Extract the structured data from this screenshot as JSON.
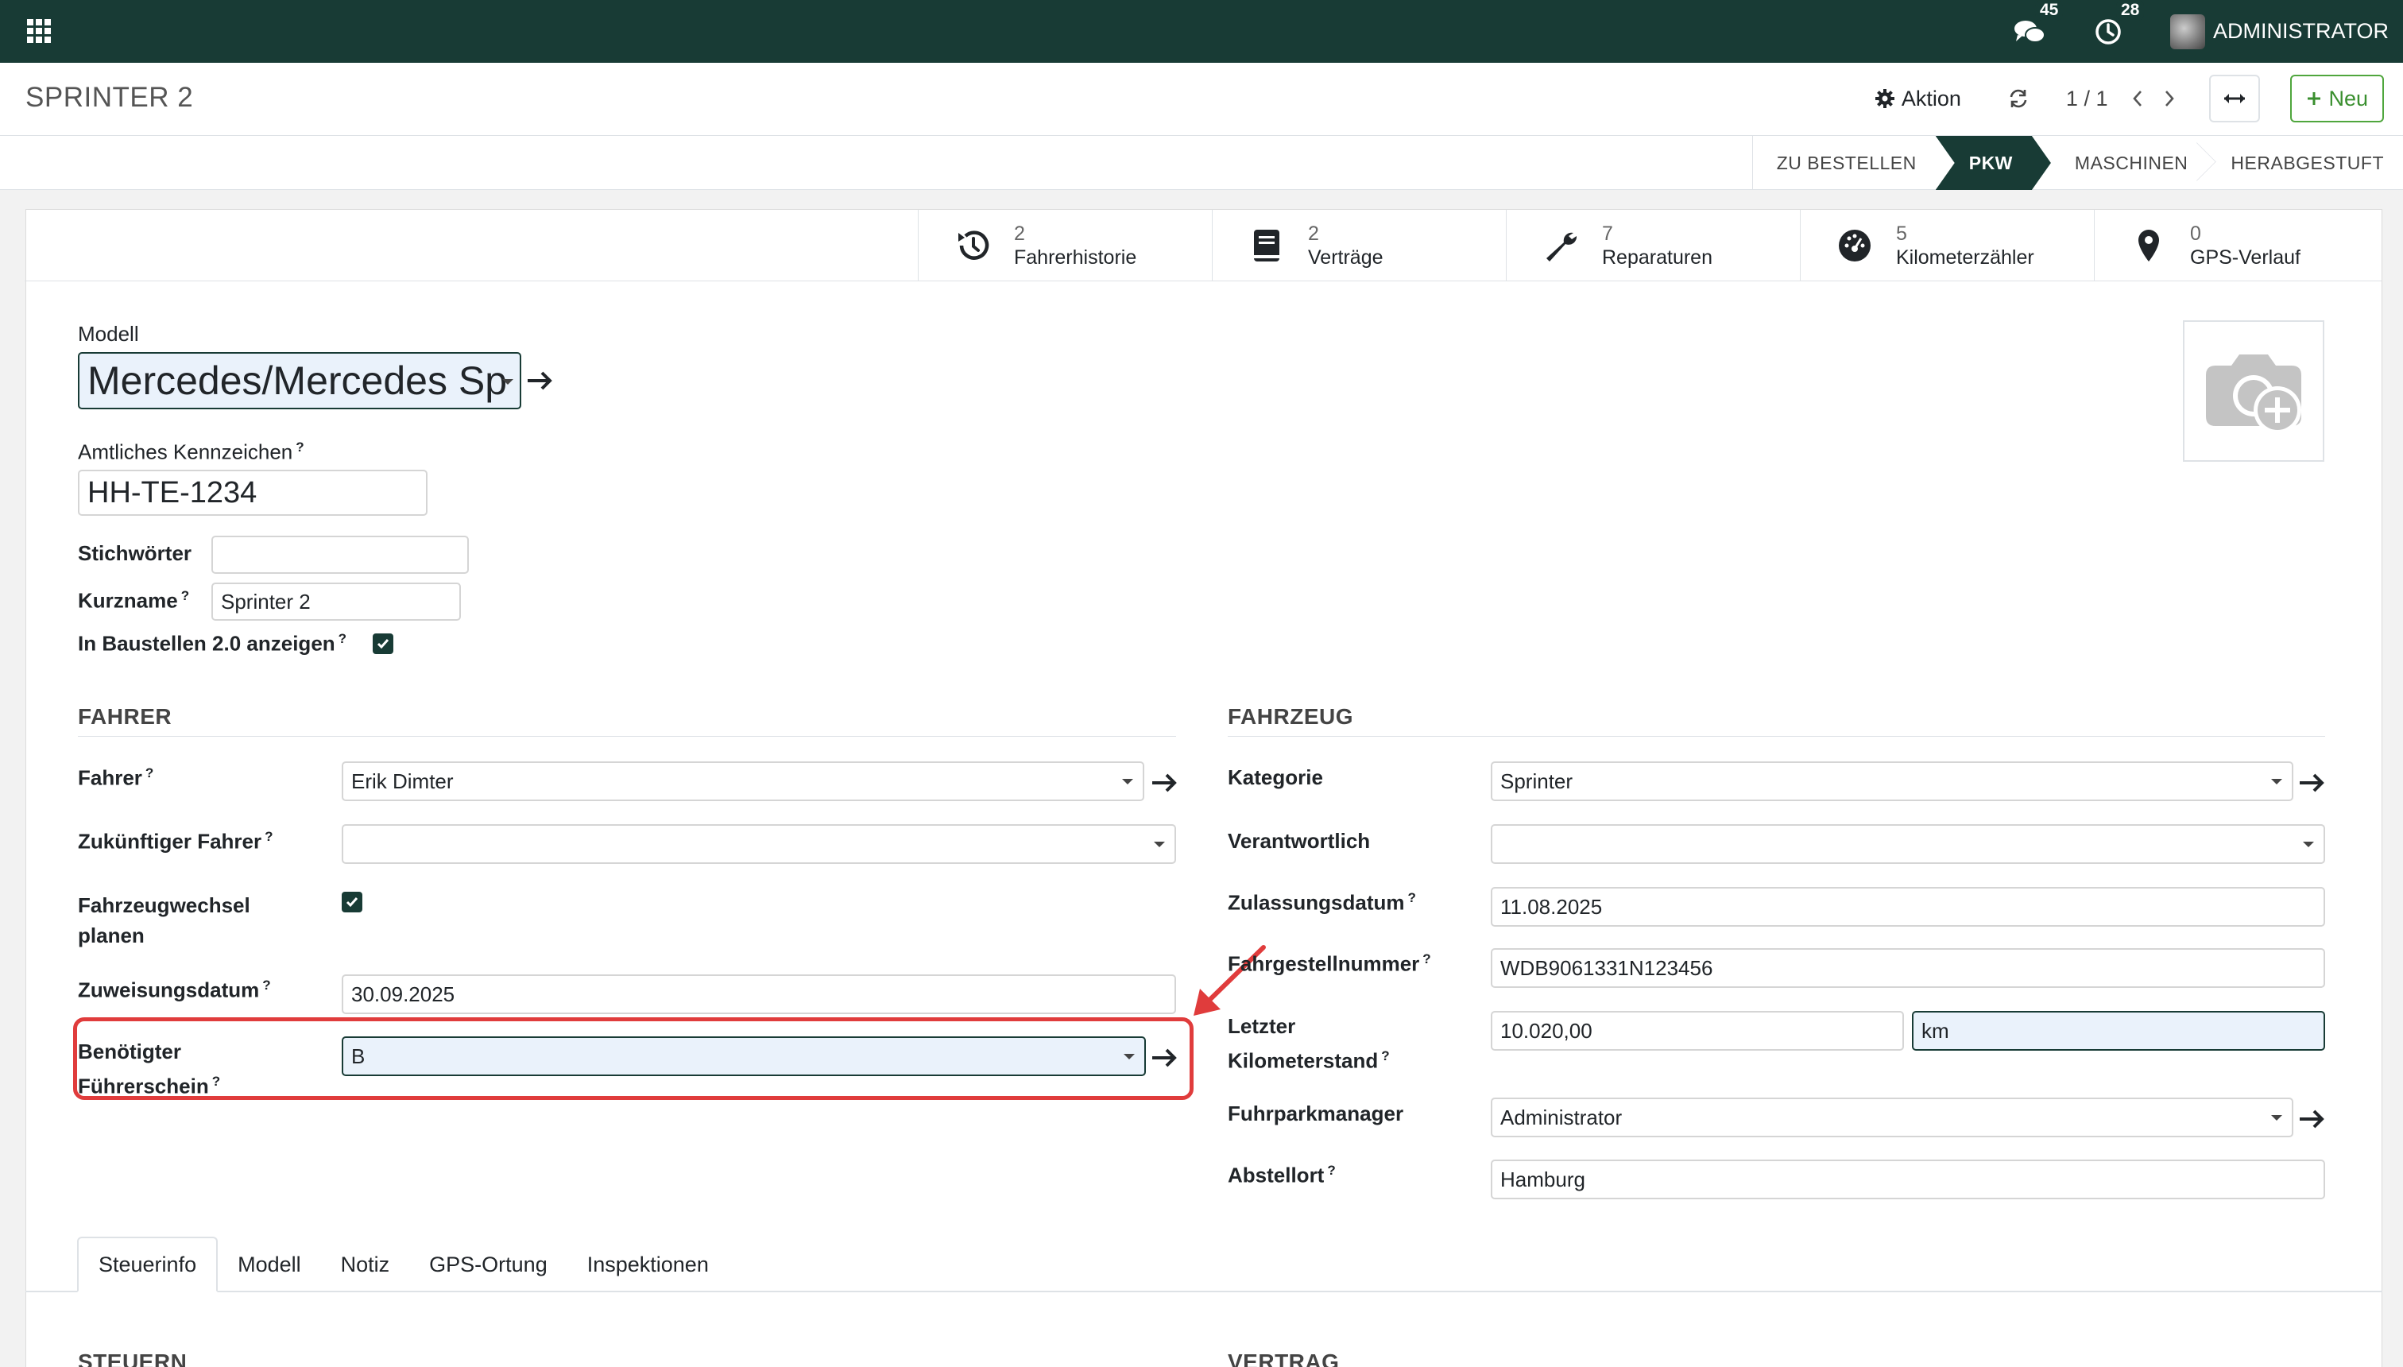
{
  "navbar": {
    "messages_count": "45",
    "activities_count": "28",
    "user_name": "ADMINISTRATOR"
  },
  "control": {
    "title": "SPRINTER 2",
    "action_label": "Aktion",
    "pager": "1 / 1",
    "new_label": "Neu"
  },
  "statusbar": {
    "stages": [
      "ZU BESTELLEN",
      "PKW",
      "MASCHINEN",
      "HERABGESTUFT"
    ],
    "active": "PKW"
  },
  "smart_buttons": [
    {
      "count": "2",
      "label": "Fahrerhistorie",
      "icon": "history-icon"
    },
    {
      "count": "2",
      "label": "Verträge",
      "icon": "book-icon"
    },
    {
      "count": "7",
      "label": "Reparaturen",
      "icon": "wrench-icon"
    },
    {
      "count": "5",
      "label": "Kilometerzähler",
      "icon": "tachometer-icon"
    },
    {
      "count": "0",
      "label": "GPS-Verlauf",
      "icon": "map-marker-icon"
    }
  ],
  "form": {
    "model_label": "Modell",
    "model_value": "Mercedes/Mercedes Sp",
    "plate_label": "Amtliches Kennzeichen",
    "plate_value": "HH-TE-1234",
    "tags_label": "Stichwörter",
    "tags_value": "",
    "shortname_label": "Kurzname",
    "shortname_value": "Sprinter 2",
    "show_baustellen_label": "In Baustellen 2.0 anzeigen",
    "show_baustellen_checked": true
  },
  "driver_section": {
    "title": "FAHRER",
    "driver_label": "Fahrer",
    "driver_value": "Erik Dimter",
    "future_driver_label": "Zukünftiger Fahrer",
    "future_driver_value": "",
    "plan_change_label_1": "Fahrzeugwechsel",
    "plan_change_label_2": "planen",
    "plan_change_checked": true,
    "assign_date_label": "Zuweisungsdatum",
    "assign_date_value": "30.09.2025",
    "license_label_1": "Benötigter",
    "license_label_2": "Führerschein",
    "license_value": "B"
  },
  "vehicle_section": {
    "title": "FAHRZEUG",
    "category_label": "Kategorie",
    "category_value": "Sprinter",
    "responsible_label": "Verantwortlich",
    "responsible_value": "",
    "registration_label": "Zulassungsdatum",
    "registration_value": "11.08.2025",
    "vin_label": "Fahrgestellnummer",
    "vin_value": "WDB9061331N123456",
    "odometer_label_1": "Letzter",
    "odometer_label_2": "Kilometerstand",
    "odometer_value": "10.020,00",
    "odometer_unit": "km",
    "fleet_manager_label": "Fuhrparkmanager",
    "fleet_manager_value": "Administrator",
    "location_label": "Abstellort",
    "location_value": "Hamburg"
  },
  "tabs": [
    "Steuerinfo",
    "Modell",
    "Notiz",
    "GPS-Ortung",
    "Inspektionen"
  ],
  "bottom_sections": {
    "left": "STEUERN",
    "right": "VERTRAG"
  },
  "colors": {
    "navbar": "#183b35",
    "highlight": "#e03c3c",
    "new_button": "#4fa63d"
  }
}
